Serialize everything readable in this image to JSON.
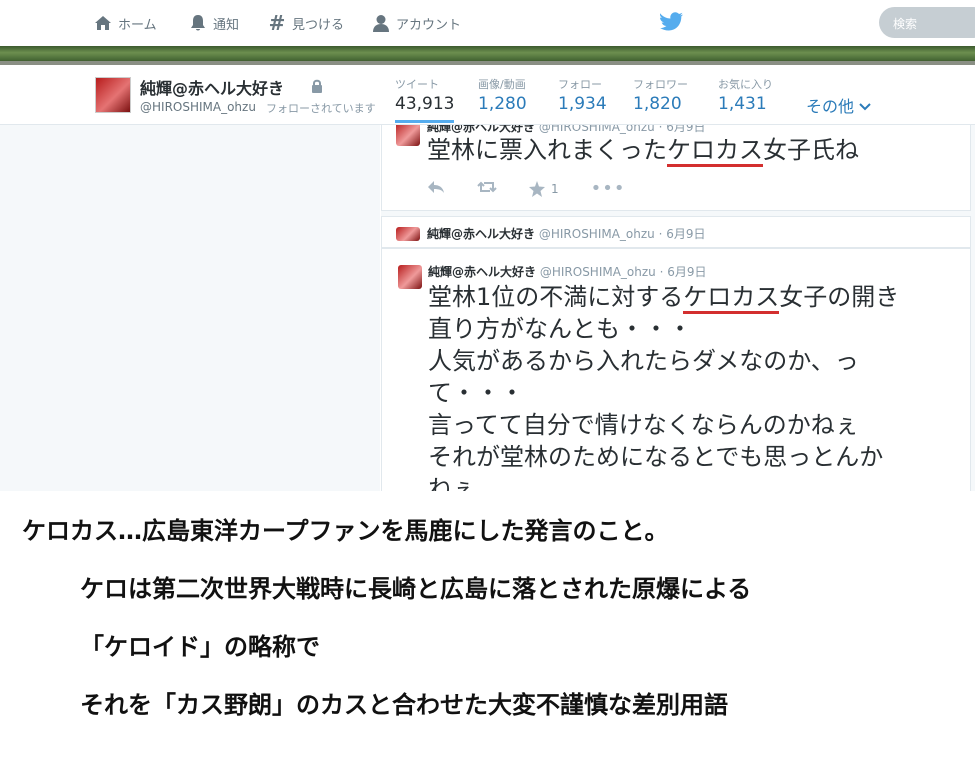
{
  "nav": {
    "home": "ホーム",
    "notifications": "通知",
    "discover": "見つける",
    "account": "アカウント",
    "search_placeholder": "検索"
  },
  "profile": {
    "name": "純輝@赤ヘル大好き",
    "handle": "@HIROSHIMA_ohzu",
    "follows_you": "フォローされています",
    "stats": [
      {
        "label": "ツイート",
        "value": "43,913"
      },
      {
        "label": "画像/動画",
        "value": "1,280"
      },
      {
        "label": "フォロー",
        "value": "1,934"
      },
      {
        "label": "フォロワー",
        "value": "1,820"
      },
      {
        "label": "お気に入り",
        "value": "1,431"
      }
    ],
    "more": "その他"
  },
  "tweets": [
    {
      "name": "純輝@赤ヘル大好き",
      "handle": "@HIROSHIMA_ohzu",
      "date": "· 6月9日",
      "text_before": "堂林に票入れまくった",
      "text_highlight": "ケロカス",
      "text_after": "女子氏ね",
      "fav_count": "1"
    },
    {
      "name": "純輝@赤ヘル大好き",
      "handle": "@HIROSHIMA_ohzu",
      "date": "· 6月9日"
    },
    {
      "name": "純輝@赤ヘル大好き",
      "handle": "@HIROSHIMA_ohzu",
      "date": "· 6月9日",
      "line1_before": "堂林1位の不満に対する",
      "line1_highlight": "ケロカス",
      "line1_after": "女子の開き",
      "line2": "直り方がなんとも・・・",
      "line3": "人気があるから入れたらダメなのか、っ",
      "line4": "て・・・",
      "line5": "言ってて自分で情けなくならんのかねぇ",
      "line6": "それが堂林のためになるとでも思っとんか",
      "line7": "ねぇ"
    }
  ],
  "caption": {
    "line1": "ケロカス…広島東洋カープファンを馬鹿にした発言のこと。",
    "line2": "ケロは第二次世界大戦時に長崎と広島に落とされた原爆による",
    "line3": "「ケロイド」の略称で",
    "line4": "それを「カス野朗」のカスと合わせた大変不謹慎な差別用語"
  },
  "colors": {
    "link": "#2b7bb9",
    "twitter_blue": "#55acee",
    "underline": "#d32f2f"
  }
}
